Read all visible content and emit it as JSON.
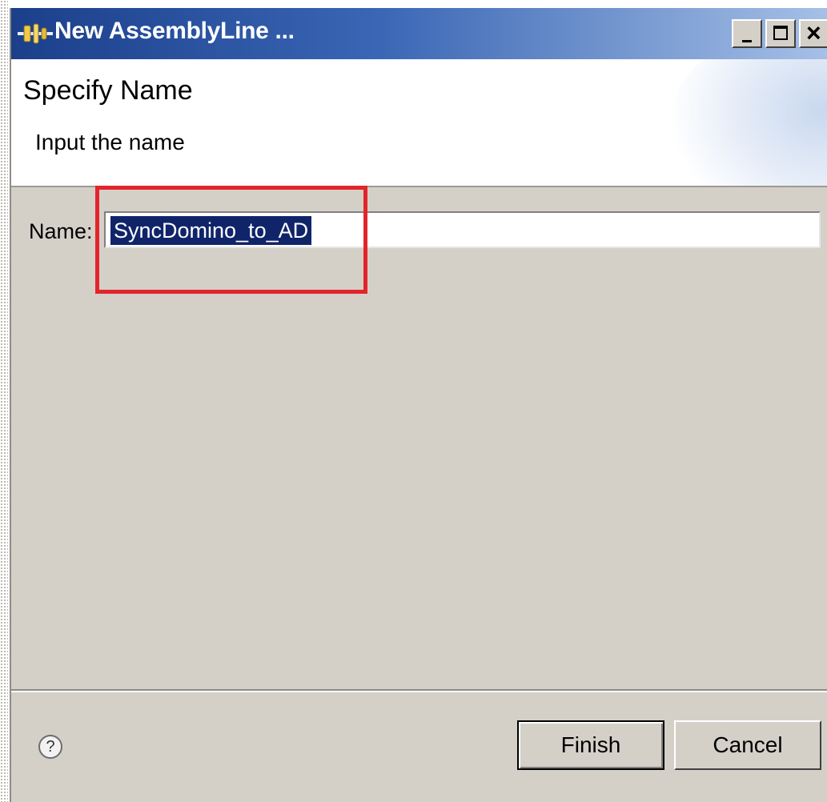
{
  "window": {
    "title": "New AssemblyLine ...",
    "icon": "assemblyline-icon",
    "controls": [
      "minimize",
      "maximize",
      "close"
    ]
  },
  "banner": {
    "title": "Specify Name",
    "subtitle": "Input the name"
  },
  "form": {
    "name_label": "Name:",
    "name_value": "SyncDomino_to_AD",
    "name_selected": true
  },
  "footer": {
    "finish_label": "Finish",
    "cancel_label": "Cancel",
    "help_glyph": "?"
  },
  "annotation": {
    "highlight_color": "#e3242b"
  },
  "colors": {
    "title_bar_start": "#1b3f8b",
    "dialog_background": "#d4d0c8",
    "selection": "#10246a"
  }
}
